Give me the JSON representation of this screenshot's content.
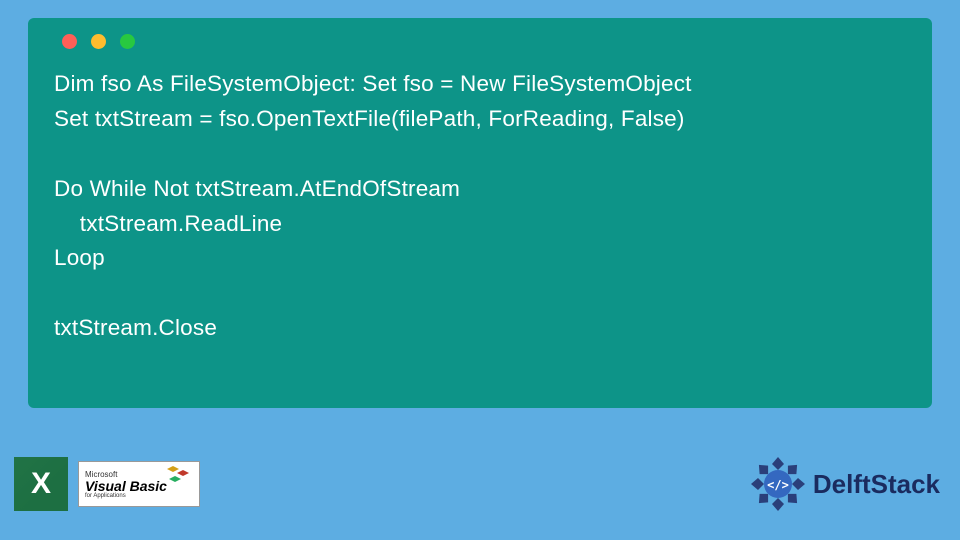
{
  "code": {
    "lines": [
      "Dim fso As FileSystemObject: Set fso = New FileSystemObject",
      "Set txtStream = fso.OpenTextFile(filePath, ForReading, False)",
      "",
      "Do While Not txtStream.AtEndOfStream",
      "    txtStream.ReadLine",
      "Loop",
      "",
      "txtStream.Close"
    ]
  },
  "logos": {
    "excel": {
      "letter": "X"
    },
    "vb": {
      "top": "Microsoft",
      "main": "Visual Basic",
      "sub": "for Applications"
    },
    "delft": {
      "text": "DelftStack",
      "code_glyph": "</>"
    }
  },
  "colors": {
    "page_bg": "#5dade2",
    "code_bg": "#0d9488",
    "code_fg": "#ffffff",
    "dot_red": "#ff5f57",
    "dot_yellow": "#febc2e",
    "dot_green": "#28c840",
    "excel_green": "#1d6f42",
    "delft_text": "#1a2b5f"
  }
}
